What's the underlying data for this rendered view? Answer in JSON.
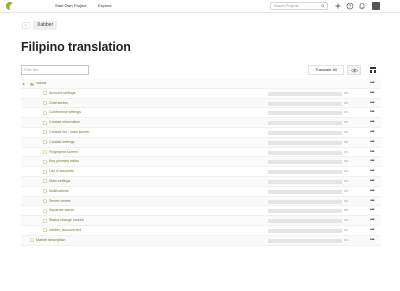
{
  "topbar": {
    "nav": [
      "Start Own Project",
      "Explore"
    ],
    "search_placeholder": "Search Projects",
    "icons": [
      "search-icon",
      "plus-icon",
      "help-icon",
      "bell-icon",
      "settings-icon",
      "avatar"
    ]
  },
  "breadcrumb": {
    "back": "‹",
    "project": "Xabber"
  },
  "title": "Filipino translation",
  "toolbar": {
    "filter_placeholder": "Filter files",
    "translate_all": "Translate All",
    "icons": [
      "eye-icon",
      "tree-icon"
    ]
  },
  "files": [
    {
      "name": "values",
      "type": "folder",
      "percent": ""
    },
    {
      "name": "Account settings",
      "type": "file",
      "percent": "0%"
    },
    {
      "name": "Chat screen",
      "type": "file",
      "percent": "0%"
    },
    {
      "name": "Conference settings",
      "type": "file",
      "percent": "0%"
    },
    {
      "name": "Contact information",
      "type": "file",
      "percent": "0%"
    },
    {
      "name": "Contact list - main screen",
      "type": "file",
      "percent": "0%"
    },
    {
      "name": "Contact settings",
      "type": "file",
      "percent": "0%"
    },
    {
      "name": "Fingerprint screen",
      "type": "file",
      "percent": "0%"
    },
    {
      "name": "Key phrases editor",
      "type": "file",
      "percent": "0%"
    },
    {
      "name": "List of accounts",
      "type": "file",
      "percent": "0%"
    },
    {
      "name": "Main settings",
      "type": "file",
      "percent": "0%"
    },
    {
      "name": "Notifications",
      "type": "file",
      "percent": "0%"
    },
    {
      "name": "Secret viewer",
      "type": "file",
      "percent": "0%"
    },
    {
      "name": "Separate words",
      "type": "file",
      "percent": "0%"
    },
    {
      "name": "Status change screen",
      "type": "file",
      "percent": "0%"
    },
    {
      "name": "xabber_account.xml",
      "type": "file",
      "percent": "0%"
    },
    {
      "name": "Market description",
      "type": "file",
      "percent": "0%"
    }
  ],
  "colors": {
    "accent": "#8bb82c",
    "folder": "#c9b44a",
    "file_text": "#6c7a2b"
  }
}
